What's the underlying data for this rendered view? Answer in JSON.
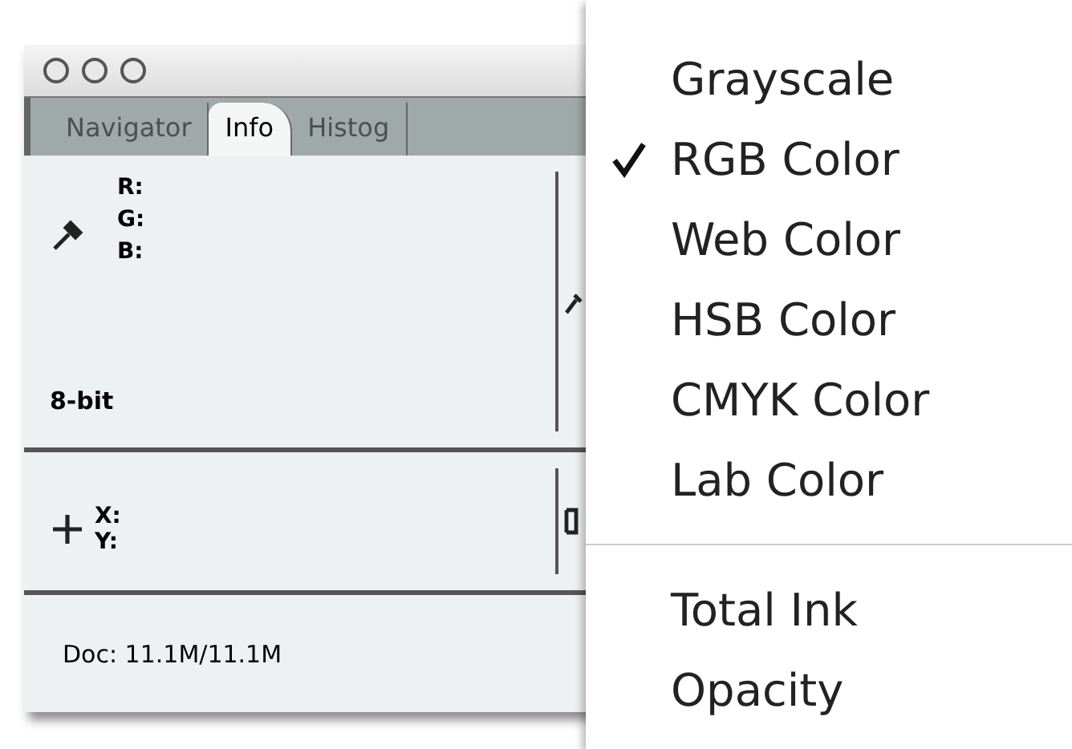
{
  "window": {
    "tabs": [
      {
        "label": "Navigator",
        "selected": false
      },
      {
        "label": "Info",
        "selected": true
      },
      {
        "label": "Histog",
        "selected": false
      }
    ],
    "color_readout": {
      "labels": [
        "R:",
        "G:",
        "B:"
      ],
      "bit_depth": "8-bit"
    },
    "position_readout": {
      "labels": [
        "X:",
        "Y:"
      ]
    },
    "status": "Doc: 11.1M/11.1M"
  },
  "menu": {
    "groups": [
      [
        {
          "label": "Grayscale",
          "checked": false
        },
        {
          "label": "RGB Color",
          "checked": true
        },
        {
          "label": "Web Color",
          "checked": false
        },
        {
          "label": "HSB Color",
          "checked": false
        },
        {
          "label": "CMYK Color",
          "checked": false
        },
        {
          "label": "Lab Color",
          "checked": false
        }
      ],
      [
        {
          "label": "Total Ink",
          "checked": false
        },
        {
          "label": "Opacity",
          "checked": false
        }
      ]
    ]
  }
}
